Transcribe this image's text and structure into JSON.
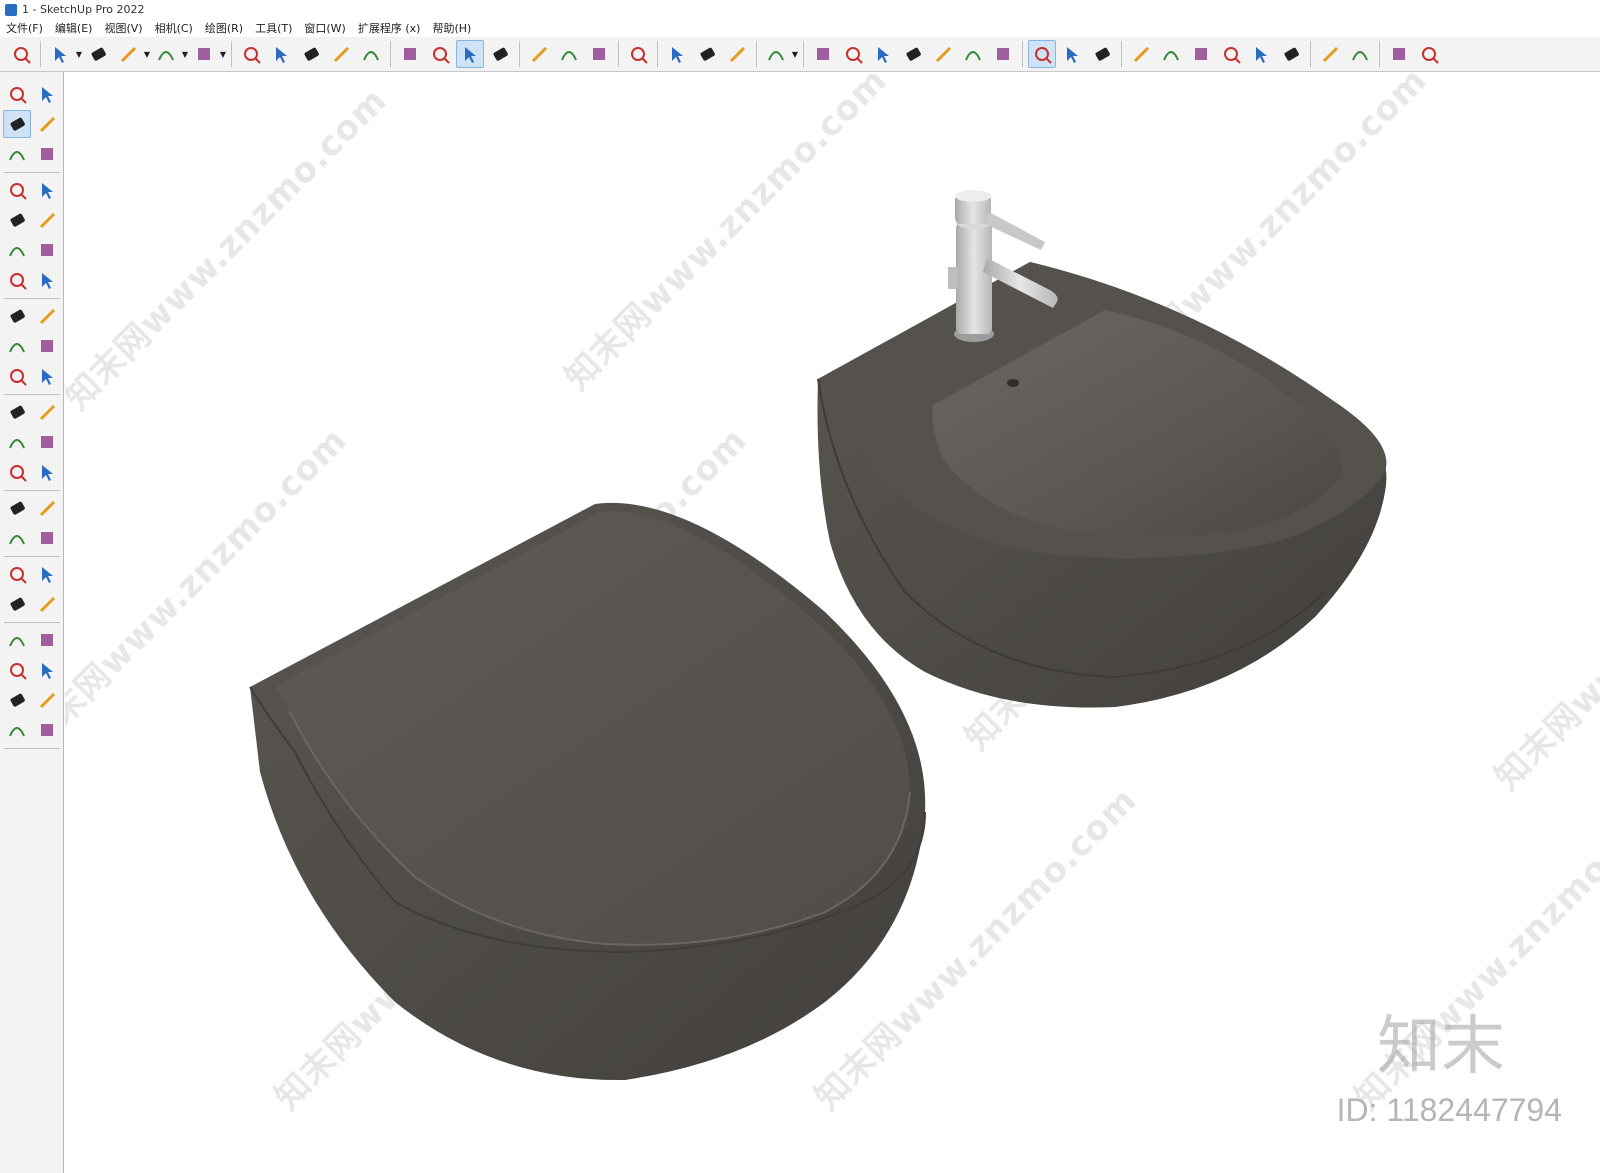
{
  "window": {
    "title": "1 - SketchUp Pro 2022"
  },
  "menu": {
    "items": [
      "文件(F)",
      "编辑(E)",
      "视图(V)",
      "相机(C)",
      "绘图(R)",
      "工具(T)",
      "窗口(W)",
      "扩展程序 (x)",
      "帮助(H)"
    ]
  },
  "toolbar": {
    "icons": [
      "zoom-icon",
      "select-icon",
      "eraser-icon",
      "pencil-icon",
      "arc-icon",
      "rectangle-icon",
      "push-pull-icon",
      "follow-me-icon",
      "move-icon",
      "rotate-icon",
      "scale-icon",
      "tape-measure-icon",
      "text-icon",
      "paint-bucket-icon",
      "orbit-icon",
      "pan-icon",
      "zoom-window-icon",
      "zoom-extents-icon",
      "warehouse-icon",
      "extension-warehouse-icon",
      "layout-icon",
      "sandbox-icon",
      "account-icon",
      "iso-view-icon",
      "top-view-icon",
      "front-view-icon",
      "right-view-icon",
      "back-view-icon",
      "left-view-icon",
      "section-plane-icon",
      "section-fill-icon",
      "styles-icon",
      "camera-icon",
      "add-location-icon",
      "shadow-icon",
      "fog-icon",
      "match-photo-icon",
      "cloud-icon",
      "settings-icon",
      "components-icon",
      "info-icon",
      "cart-icon",
      "profile-icon"
    ]
  },
  "left_toolbar": {
    "icons": [
      "select-icon",
      "orbit-icon",
      "paint-bucket-icon",
      "eraser-icon",
      "component-icon",
      "pencil-tag-icon",
      "line-icon",
      "freehand-icon",
      "rectangle-icon",
      "rotated-rectangle-icon",
      "circle-icon",
      "polygon-icon",
      "arc-icon",
      "two-point-arc-icon",
      "three-point-arc-icon",
      "pie-icon",
      "move-icon",
      "push-pull-icon",
      "rotate-icon",
      "follow-me-icon",
      "scale-icon",
      "offset-icon",
      "tape-measure-icon",
      "dimension-icon",
      "protractor-icon",
      "text-icon",
      "axes-icon",
      "3d-text-icon",
      "orbit2-icon",
      "pan-icon",
      "zoom-icon",
      "zoom-window-icon",
      "zoom-extents-icon",
      "previous-view-icon",
      "position-camera-icon",
      "look-around-icon",
      "walk-icon",
      "section-plane-icon",
      "warehouse-icon",
      "extension-icon",
      "layers-icon",
      "sandbox-icon"
    ]
  },
  "scene": {
    "watermark_text": "知末网www.znzmo.com",
    "brand_mark": "知末",
    "brand_id": "ID: 1182447794",
    "product_color": "#4f4c48",
    "faucet_color": "#c9c9c9"
  }
}
